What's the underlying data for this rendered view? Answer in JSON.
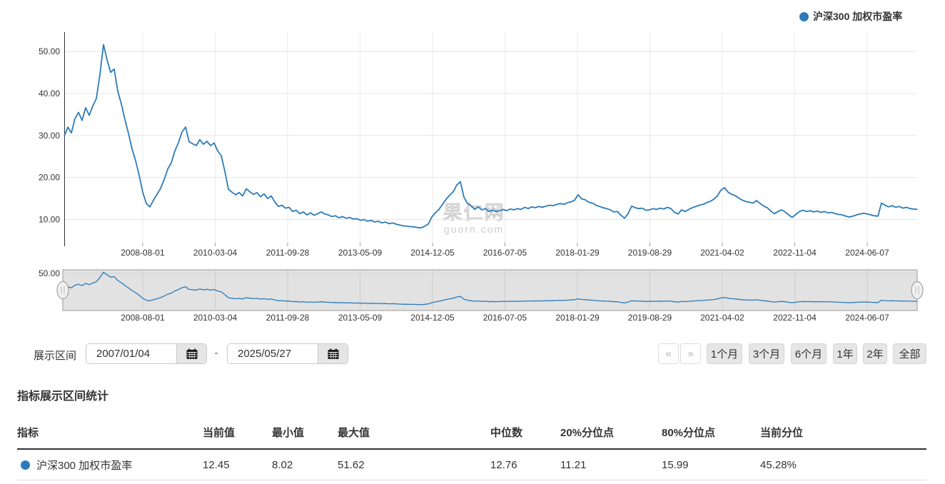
{
  "legend": {
    "label": "沪深300 加权市盈率",
    "color": "#2b7bb9"
  },
  "watermark": {
    "title": "果仁网",
    "subtitle": "guorn.com"
  },
  "chart_data": {
    "type": "line",
    "title": "",
    "legend_position": "top-right",
    "grid": true,
    "x_start": "2007/01/04",
    "x_end": "2025/05/27",
    "y_tick_labels": [
      "10.00",
      "20.00",
      "30.00",
      "40.00",
      "50.00"
    ],
    "y_tick_values": [
      10,
      20,
      30,
      40,
      50
    ],
    "ylim": [
      4.5,
      54.6
    ],
    "x_ticks": [
      {
        "label": "2008-08-01",
        "frac": 0.092
      },
      {
        "label": "2010-03-04",
        "frac": 0.177
      },
      {
        "label": "2011-09-28",
        "frac": 0.2619
      },
      {
        "label": "2013-05-09",
        "frac": 0.3469
      },
      {
        "label": "2014-12-05",
        "frac": 0.4318
      },
      {
        "label": "2016-07-05",
        "frac": 0.5167
      },
      {
        "label": "2018-01-29",
        "frac": 0.6017
      },
      {
        "label": "2019-08-29",
        "frac": 0.6866
      },
      {
        "label": "2021-04-02",
        "frac": 0.7715
      },
      {
        "label": "2022-11-04",
        "frac": 0.8565
      },
      {
        "label": "2024-06-07",
        "frac": 0.9414
      }
    ],
    "navigator": {
      "y_top_label": "50.00",
      "ylim": [
        0,
        54.8
      ]
    },
    "series": [
      {
        "name": "沪深300 加权市盈率",
        "color": "#2b7bb9",
        "values": [
          29.8,
          32.0,
          30.6,
          34.0,
          35.5,
          33.6,
          36.6,
          34.8,
          37.0,
          38.8,
          44.5,
          51.62,
          48.0,
          45.0,
          45.8,
          40.5,
          37.5,
          33.8,
          30.5,
          26.8,
          24.0,
          20.5,
          16.5,
          13.8,
          13.0,
          14.6,
          16.0,
          17.4,
          19.5,
          22.0,
          23.5,
          26.3,
          28.3,
          30.8,
          32.0,
          28.5,
          28.0,
          27.6,
          29.0,
          27.9,
          28.6,
          27.6,
          28.2,
          26.3,
          25.2,
          21.5,
          17.2,
          16.5,
          15.9,
          16.4,
          15.6,
          17.3,
          16.6,
          16.0,
          16.4,
          15.4,
          16.1,
          15.0,
          15.6,
          14.2,
          13.1,
          13.4,
          12.7,
          12.9,
          11.9,
          12.2,
          11.4,
          11.8,
          11.1,
          11.6,
          11.0,
          11.4,
          11.8,
          11.3,
          11.1,
          10.7,
          10.9,
          10.4,
          10.7,
          10.3,
          10.5,
          10.1,
          10.2,
          9.8,
          10.0,
          9.6,
          9.8,
          9.4,
          9.6,
          9.2,
          9.4,
          9.0,
          9.2,
          8.9,
          8.7,
          8.5,
          8.4,
          8.3,
          8.25,
          8.1,
          8.02,
          8.4,
          8.9,
          10.6,
          11.6,
          12.4,
          13.6,
          14.8,
          15.8,
          16.6,
          18.2,
          19.0,
          15.3,
          13.8,
          13.3,
          12.4,
          13.0,
          12.3,
          12.6,
          11.9,
          12.2,
          11.9,
          12.1,
          12.4,
          12.1,
          12.5,
          12.3,
          12.6,
          12.4,
          12.9,
          12.6,
          13.0,
          12.8,
          13.1,
          12.9,
          13.2,
          13.4,
          13.3,
          13.6,
          13.8,
          13.6,
          14.0,
          14.2,
          14.6,
          15.9,
          14.9,
          14.7,
          14.1,
          13.9,
          13.4,
          13.1,
          12.8,
          12.6,
          12.3,
          11.8,
          11.9,
          11.0,
          10.3,
          11.4,
          13.2,
          12.8,
          12.6,
          12.7,
          12.2,
          12.3,
          12.6,
          12.4,
          12.7,
          12.5,
          12.9,
          12.6,
          11.7,
          11.3,
          12.3,
          11.9,
          12.4,
          12.8,
          13.1,
          13.4,
          13.6,
          14.0,
          14.3,
          14.8,
          15.6,
          17.0,
          17.6,
          16.5,
          16.0,
          15.7,
          15.1,
          14.6,
          14.3,
          14.1,
          13.9,
          14.5,
          13.8,
          13.2,
          12.8,
          12.0,
          11.4,
          11.9,
          12.3,
          11.8,
          11.1,
          10.5,
          11.2,
          11.9,
          12.2,
          11.9,
          12.1,
          11.8,
          12.0,
          11.7,
          11.9,
          11.6,
          11.7,
          11.4,
          11.2,
          11.1,
          10.8,
          10.6,
          10.8,
          11.1,
          11.3,
          11.5,
          11.3,
          11.1,
          10.9,
          10.8,
          13.9,
          13.4,
          13.0,
          13.3,
          12.9,
          13.1,
          12.7,
          12.9,
          12.6,
          12.5,
          12.45
        ]
      }
    ]
  },
  "controls": {
    "range_label": "展示区间",
    "start_date": "2007/01/04",
    "end_date": "2025/05/27",
    "separator": "-",
    "prev_icon": "«",
    "next_icon": "»",
    "range_buttons": [
      "1个月",
      "3个月",
      "6个月",
      "1年",
      "2年",
      "全部"
    ]
  },
  "stats": {
    "title": "指标展示区间统计",
    "headers": [
      "指标",
      "当前值",
      "最小值",
      "最大值",
      "中位数",
      "20%分位点",
      "80%分位点",
      "当前分位"
    ],
    "row": {
      "name": "沪深300 加权市盈率",
      "values": [
        "12.45",
        "8.02",
        "51.62",
        "12.76",
        "11.21",
        "15.99",
        "45.28%"
      ]
    }
  }
}
